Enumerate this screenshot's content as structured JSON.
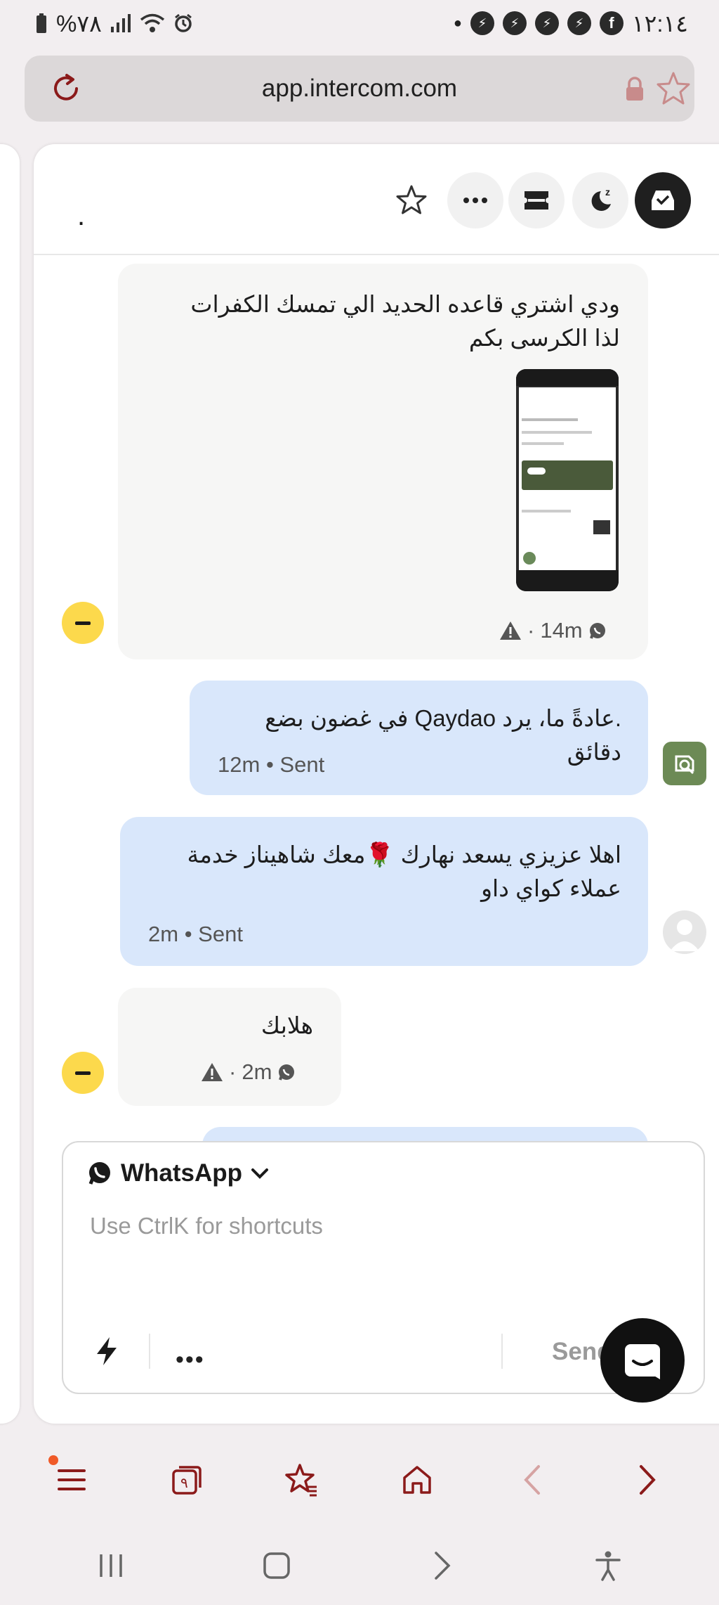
{
  "status_bar": {
    "battery": "%٧٨",
    "time": "١٢:١٤"
  },
  "browser": {
    "url": "app.intercom.com"
  },
  "conversation": {
    "title_dot": ".",
    "messages": [
      {
        "direction": "in",
        "text": "ودي اشتري قاعده الحديد الي تمسك الكفرات لذا الكرسى بكم",
        "meta_time": "14m",
        "has_image": true
      },
      {
        "direction": "out",
        "text": ".عادةً ما، يرد Qaydao في غضون بضع دقائق",
        "meta_time": "12m",
        "meta_status": "Sent"
      },
      {
        "direction": "out",
        "text": "اهلا عزيزي يسعد نهارك 🌹معك شاهيناز خدمة عملاء كواي داو",
        "meta_time": "2m",
        "meta_status": "Sent"
      },
      {
        "direction": "in",
        "text": "هلابك",
        "meta_time": "2m"
      }
    ]
  },
  "composer": {
    "channel": "WhatsApp",
    "placeholder": "Use CtrlK for shortcuts",
    "more_label": "•••",
    "send_label": "Send"
  },
  "colors": {
    "accent_red": "#8b1a1a",
    "outbound_bubble": "#d9e7fb",
    "inbound_bubble": "#f6f6f5",
    "avatar_yellow": "#fcd94c"
  }
}
